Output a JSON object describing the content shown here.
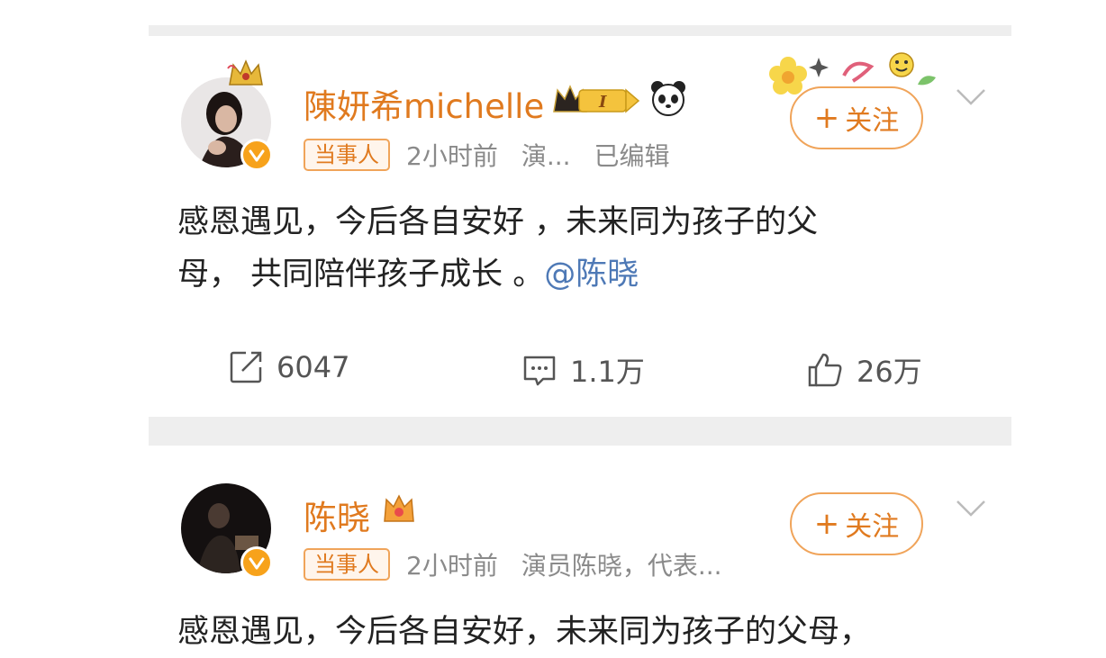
{
  "post1": {
    "username": "陳妍希michelle",
    "tag": "当事人",
    "time": "2小时前",
    "source": "演...",
    "edited": "已编辑",
    "follow_label": "关注",
    "content_line1": "感恩遇见，今后各自安好 ，未来同为孩子的父",
    "content_line2": "母， 共同陪伴孩子成长 。",
    "mention": "@陈晓",
    "repost_count": "6047",
    "comment_count": "1.1万",
    "like_count": "26万",
    "badges": [
      "crown-i-badge",
      "panda-icon"
    ]
  },
  "post2": {
    "username": "陈晓",
    "tag": "当事人",
    "time": "2小时前",
    "source": "演员陈晓，代表...",
    "follow_label": "关注",
    "content_line1": "感恩遇见，今后各自安好，未来同为孩子的父母，",
    "badges": [
      "crown-icon"
    ]
  },
  "colors": {
    "accent": "#e07a1f",
    "tag_border": "#f0a45a",
    "mention": "#4e79b6",
    "meta": "#8a8a8a",
    "verified": "#f7a21b"
  }
}
